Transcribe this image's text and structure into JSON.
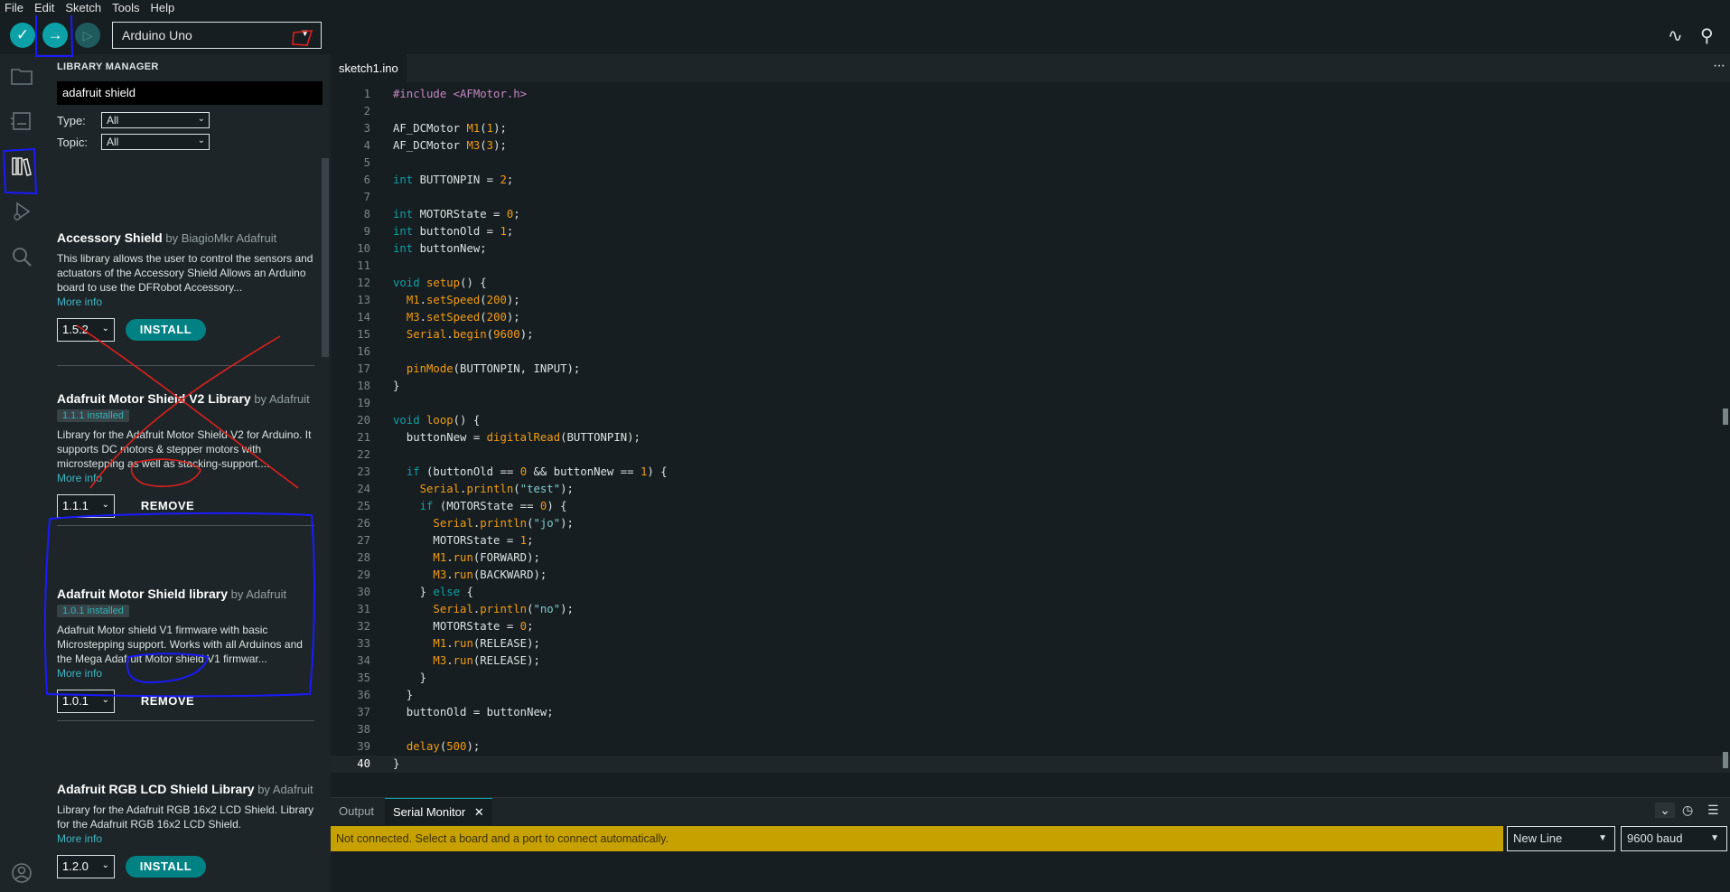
{
  "menu": [
    "File",
    "Edit",
    "Sketch",
    "Tools",
    "Help"
  ],
  "toolbar": {
    "verify_icon": "check-icon",
    "upload_icon": "arrow-right-icon",
    "debug_icon": "debug-icon",
    "board": "Arduino Uno",
    "serial_plotter_icon": "plotter-icon",
    "serial_monitor_icon": "monitor-icon"
  },
  "activity": [
    "folder-icon",
    "board-icon",
    "library-icon",
    "debug-icon",
    "search-icon",
    "account-icon"
  ],
  "library_manager": {
    "title": "LIBRARY MANAGER",
    "search": "adafruit shield",
    "type_label": "Type:",
    "type_value": "All",
    "topic_label": "Topic:",
    "topic_value": "All",
    "items": [
      {
        "name": "Accessory Shield",
        "by": "by BiagioMkr Adafruit",
        "installed": "",
        "desc": "This library allows the user to control the sensors and actuators of the Accessory Shield Allows an Arduino board to use the DFRobot Accessory...",
        "more": "More info",
        "version": "1.5.2",
        "action": "INSTALL"
      },
      {
        "name": "Adafruit Motor Shield V2 Library",
        "by": "by Adafruit",
        "installed": "1.1.1 installed",
        "desc": "Library for the Adafruit Motor Shield V2 for Arduino. It supports DC motors & stepper motors with microstepping as well as stacking-support....",
        "more": "More info",
        "version": "1.1.1",
        "action": "REMOVE"
      },
      {
        "name": "Adafruit Motor Shield library",
        "by": "by Adafruit",
        "installed": "1.0.1 installed",
        "desc": "Adafruit Motor shield V1 firmware with basic Microstepping support. Works with all Arduinos and the Mega Adafruit Motor shield V1 firmwar...",
        "more": "More info",
        "version": "1.0.1",
        "action": "REMOVE"
      },
      {
        "name": "Adafruit RGB LCD Shield Library",
        "by": "by Adafruit",
        "installed": "",
        "desc": "Library for the Adafruit RGB 16x2 LCD Shield. Library for the Adafruit RGB 16x2 LCD Shield.",
        "more": "More info",
        "version": "1.2.0",
        "action": "INSTALL"
      }
    ]
  },
  "editor": {
    "tab": "sketch1.ino",
    "more_icon": "ellipsis-icon",
    "current_line": 40,
    "lines": [
      "#include <AFMotor.h>",
      "",
      "AF_DCMotor M1(1);",
      "AF_DCMotor M3(3);",
      "",
      "int BUTTONPIN = 2;",
      "",
      "int MOTORState = 0;",
      "int buttonOld = 1;",
      "int buttonNew;",
      "",
      "void setup() {",
      "  M1.setSpeed(200);",
      "  M3.setSpeed(200);",
      "  Serial.begin(9600);",
      "",
      "  pinMode(BUTTONPIN, INPUT);",
      "}",
      "",
      "void loop() {",
      "  buttonNew = digitalRead(BUTTONPIN);",
      "",
      "  if (buttonOld == 0 && buttonNew == 1) {",
      "    Serial.println(\"test\");",
      "    if (MOTORState == 0) {",
      "      Serial.println(\"jo\");",
      "      MOTORState = 1;",
      "      M1.run(FORWARD);",
      "      M3.run(BACKWARD);",
      "    } else {",
      "      Serial.println(\"no\");",
      "      MOTORState = 0;",
      "      M1.run(RELEASE);",
      "      M3.run(RELEASE);",
      "    }",
      "  }",
      "  buttonOld = buttonNew;",
      "",
      "  delay(500);",
      "}"
    ]
  },
  "bottom_panel": {
    "tabs": [
      "Output",
      "Serial Monitor"
    ],
    "close_icon": "close-icon",
    "notice": "Not connected. Select a board and a port to connect automatically.",
    "line_ending": "New Line",
    "baud": "9600 baud"
  },
  "colors": {
    "accent": "#008184",
    "keyword": "#0ca1a6",
    "function": "#f39c12",
    "notice_bg": "#c7a100",
    "annotation_red": "#e0201c",
    "annotation_blue": "#1a1aff"
  }
}
